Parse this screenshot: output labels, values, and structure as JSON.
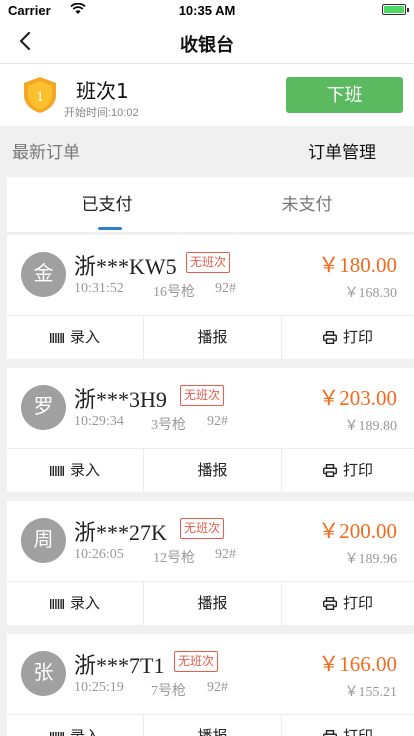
{
  "status_bar": {
    "carrier": "Carrier",
    "time": "10:35 AM"
  },
  "nav": {
    "title": "收银台"
  },
  "shift": {
    "badge_number": "1",
    "name": "班次1",
    "start_time": "开始时间:10:02",
    "off_duty_label": "下班"
  },
  "section": {
    "latest_orders": "最新订单",
    "order_management": "订单管理"
  },
  "tabs": {
    "paid": "已支付",
    "unpaid": "未支付",
    "active": "paid"
  },
  "orders": [
    {
      "avatar": "金",
      "plate": "浙***KW5",
      "tag": "无班次",
      "amount": "￥180.00",
      "time": "10:31:52",
      "gun": "16号枪",
      "oil": "92#",
      "paid": "￥168.30"
    },
    {
      "avatar": "罗",
      "plate": "浙***3H9",
      "tag": "无班次",
      "amount": "￥203.00",
      "time": "10:29:34",
      "gun": "3号枪",
      "oil": "92#",
      "paid": "￥189.80"
    },
    {
      "avatar": "周",
      "plate": "浙***27K",
      "tag": "无班次",
      "amount": "￥200.00",
      "time": "10:26:05",
      "gun": "12号枪",
      "oil": "92#",
      "paid": "￥189.96"
    },
    {
      "avatar": "张",
      "plate": "浙***7T1",
      "tag": "无班次",
      "amount": "￥166.00",
      "time": "10:25:19",
      "gun": "7号枪",
      "oil": "92#",
      "paid": "￥155.21"
    }
  ],
  "actions": {
    "record": "录入",
    "broadcast": "播报",
    "print": "打印"
  },
  "colors": {
    "accent_green": "#5bb95f",
    "amount_orange": "#f26a1b",
    "tag_red": "#e55d4d",
    "tab_indicator": "#2f7fd9"
  }
}
